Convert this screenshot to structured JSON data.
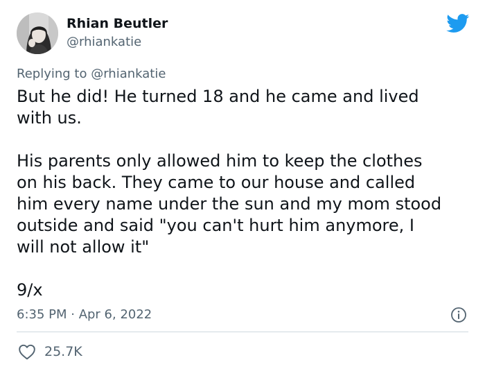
{
  "tweet": {
    "author": {
      "display_name": "Rhian Beutler",
      "handle": "@rhiankatie"
    },
    "replying_prefix": "Replying to ",
    "replying_to": "@rhiankatie",
    "text_lines": [
      "But he did! He turned 18 and he came and lived",
      "with us.",
      "",
      "His parents only allowed him to keep the clothes",
      "on his back. They came to our house and called",
      "him every name under the sun and my mom stood",
      "outside and said \"you can't hurt him anymore, I",
      "will not allow it\"",
      "",
      "9/x"
    ],
    "timestamp": "6:35 PM · Apr 6, 2022",
    "likes": "25.7K"
  },
  "icons": {
    "brand": "twitter-bird-icon",
    "info": "info-icon",
    "like": "heart-icon"
  },
  "colors": {
    "brand_blue": "#1d9bf0",
    "text_primary": "#0f1419",
    "text_secondary": "#536471",
    "divider": "#cfd9de"
  }
}
